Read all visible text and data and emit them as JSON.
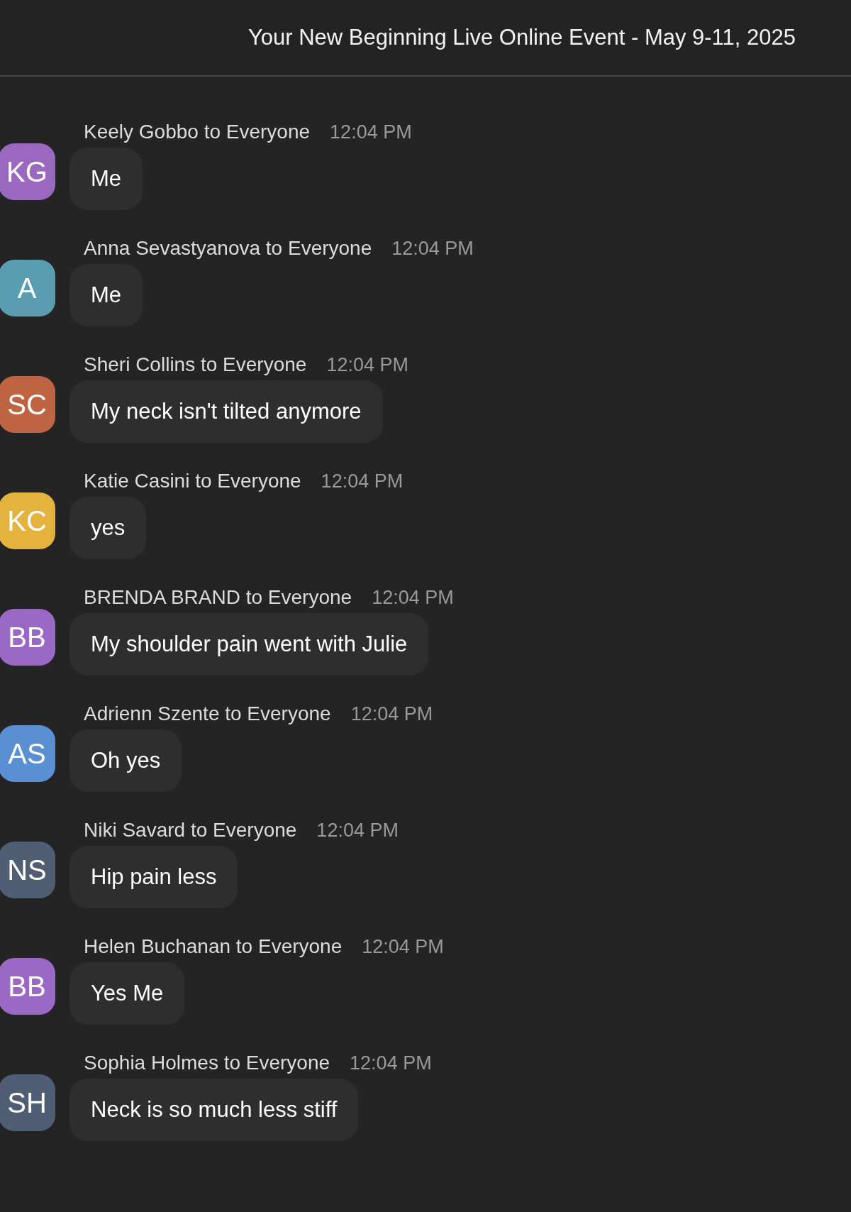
{
  "header": {
    "title": "Your New Beginning Live Online Event - May 9-11, 2025"
  },
  "messages": [
    {
      "initials": "KG",
      "color": "#9a68bf",
      "sender": "Keely Gobbo to Everyone",
      "time": "12:04 PM",
      "text": "Me"
    },
    {
      "initials": "A",
      "color": "#5a9cb0",
      "sender": "Anna Sevastyanova to Everyone",
      "time": "12:04 PM",
      "text": "Me"
    },
    {
      "initials": "SC",
      "color": "#bf6443",
      "sender": "Sheri Collins to Everyone",
      "time": "12:04 PM",
      "text": "My neck isn't tilted anymore"
    },
    {
      "initials": "KC",
      "color": "#e3b33e",
      "sender": "Katie Casini to Everyone",
      "time": "12:04 PM",
      "text": "yes"
    },
    {
      "initials": "BB",
      "color": "#9a68c5",
      "sender": "BRENDA BRAND to Everyone",
      "time": "12:04 PM",
      "text": "My shoulder pain went with Julie"
    },
    {
      "initials": "AS",
      "color": "#5b8fd3",
      "sender": "Adrienn Szente to Everyone",
      "time": "12:04 PM",
      "text": "Oh yes"
    },
    {
      "initials": "NS",
      "color": "#4f5e73",
      "sender": "Niki Savard to Everyone",
      "time": "12:04 PM",
      "text": "Hip pain less"
    },
    {
      "initials": "BB",
      "color": "#9a68c5",
      "sender": "Helen Buchanan to Everyone",
      "time": "12:04 PM",
      "text": "Yes Me"
    },
    {
      "initials": "SH",
      "color": "#4f5e75",
      "sender": "Sophia Holmes to Everyone",
      "time": "12:04 PM",
      "text": "Neck is so much less stiff"
    }
  ]
}
